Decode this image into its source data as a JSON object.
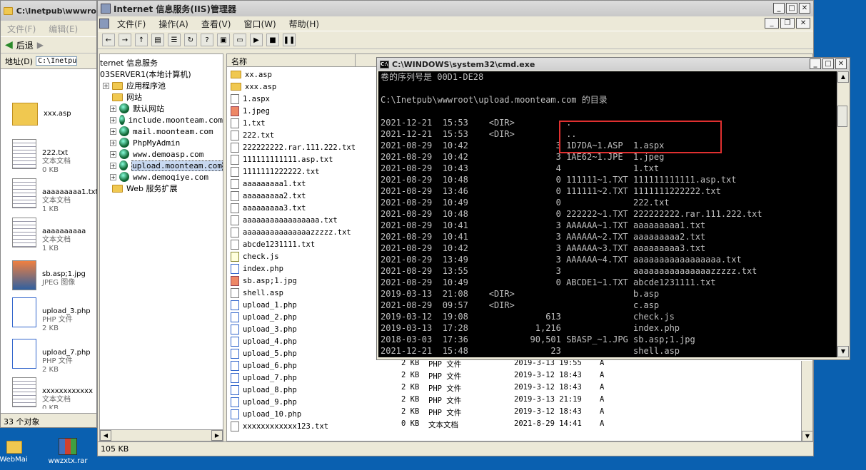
{
  "left_window": {
    "title": "C:\\Inetpub\\wwwro",
    "menu": [
      "文件(F)",
      "编辑(E)"
    ],
    "back_label": "后退",
    "address_label": "地址(D)",
    "address_value": "C:\\Inetpub\\",
    "items": [
      {
        "name": "xxx.asp",
        "type": "",
        "size": "",
        "icon": "folder"
      },
      {
        "name": "222.txt",
        "type": "文本文档",
        "size": "0 KB",
        "icon": "text"
      },
      {
        "name": "aaaaaaaaa1.txt",
        "type": "文本文档",
        "size": "1 KB",
        "icon": "text"
      },
      {
        "name": "aaaaaaaaaa",
        "type": "文本文档",
        "size": "1 KB",
        "icon": "text"
      },
      {
        "name": "sb.asp;1.jpg",
        "type": "JPEG 图像",
        "size": "",
        "icon": "image"
      },
      {
        "name": "upload_3.php",
        "type": "PHP 文件",
        "size": "2 KB",
        "icon": "php"
      },
      {
        "name": "upload_7.php",
        "type": "PHP 文件",
        "size": "2 KB",
        "icon": "php"
      },
      {
        "name": "xxxxxxxxxxxx",
        "type": "文本文档",
        "size": "0 KB",
        "icon": "text"
      }
    ],
    "status": "33 个对象"
  },
  "iis": {
    "title": "Internet 信息服务(IIS)管理器",
    "menu": [
      "文件(F)",
      "操作(A)",
      "查看(V)",
      "窗口(W)",
      "帮助(H)"
    ],
    "tree": [
      {
        "label": "ternet 信息服务",
        "indent": 0,
        "icon": "none",
        "plus": false
      },
      {
        "label": "03SERVER1(本地计算机)",
        "indent": 0,
        "icon": "none",
        "plus": false
      },
      {
        "label": "应用程序池",
        "indent": 1,
        "icon": "folder",
        "plus": true
      },
      {
        "label": "网站",
        "indent": 1,
        "icon": "folder",
        "plus": false
      },
      {
        "label": "默认网站",
        "indent": 2,
        "icon": "globe",
        "plus": true
      },
      {
        "label": "include.moonteam.com",
        "indent": 2,
        "icon": "globe",
        "plus": true
      },
      {
        "label": "mail.moonteam.com",
        "indent": 2,
        "icon": "globe",
        "plus": true
      },
      {
        "label": "PhpMyAdmin",
        "indent": 2,
        "icon": "globe",
        "plus": true
      },
      {
        "label": "www.demoasp.com",
        "indent": 2,
        "icon": "globe",
        "plus": true
      },
      {
        "label": "upload.moonteam.com",
        "indent": 2,
        "icon": "globe",
        "plus": true,
        "selected": true
      },
      {
        "label": "www.demoqiye.com",
        "indent": 2,
        "icon": "globe",
        "plus": true
      },
      {
        "label": "Web 服务扩展",
        "indent": 1,
        "icon": "folder",
        "plus": false
      }
    ],
    "col_name": "名称",
    "files": [
      {
        "name": "xx.asp",
        "icon": "f"
      },
      {
        "name": "xxx.asp",
        "icon": "f"
      },
      {
        "name": "1.aspx",
        "icon": "t"
      },
      {
        "name": "1.jpeg",
        "icon": "j"
      },
      {
        "name": "1.txt",
        "icon": "t"
      },
      {
        "name": "222.txt",
        "icon": "t"
      },
      {
        "name": "222222222.rar.111.222.txt",
        "icon": "t"
      },
      {
        "name": "111111111111.asp.txt",
        "icon": "t"
      },
      {
        "name": "1111111222222.txt",
        "icon": "t"
      },
      {
        "name": "aaaaaaaaa1.txt",
        "icon": "t"
      },
      {
        "name": "aaaaaaaaa2.txt",
        "icon": "t"
      },
      {
        "name": "aaaaaaaaa3.txt",
        "icon": "t"
      },
      {
        "name": "aaaaaaaaaaaaaaaaa.txt",
        "icon": "t"
      },
      {
        "name": "aaaaaaaaaaaaaaazzzzz.txt",
        "icon": "t"
      },
      {
        "name": "abcde1231111.txt",
        "icon": "t"
      },
      {
        "name": "check.js",
        "icon": "s"
      },
      {
        "name": "index.php",
        "icon": "p"
      },
      {
        "name": "sb.asp;1.jpg",
        "icon": "j"
      },
      {
        "name": "shell.asp",
        "icon": "t"
      },
      {
        "name": "upload_1.php",
        "icon": "p"
      },
      {
        "name": "upload_2.php",
        "icon": "p"
      },
      {
        "name": "upload_3.php",
        "icon": "p"
      },
      {
        "name": "upload_4.php",
        "icon": "p"
      },
      {
        "name": "upload_5.php",
        "icon": "p"
      },
      {
        "name": "upload_6.php",
        "icon": "p"
      },
      {
        "name": "upload_7.php",
        "icon": "p"
      },
      {
        "name": "upload_8.php",
        "icon": "p"
      },
      {
        "name": "upload_9.php",
        "icon": "p"
      },
      {
        "name": "upload_10.php",
        "icon": "p"
      },
      {
        "name": "xxxxxxxxxxxx123.txt",
        "icon": "t"
      }
    ],
    "detail_rows": [
      {
        "size": "2 KB",
        "type": "PHP 文件",
        "date": "2019-3-13 19:55",
        "attr": "A"
      },
      {
        "size": "2 KB",
        "type": "PHP 文件",
        "date": "2019-3-12 18:43",
        "attr": "A"
      },
      {
        "size": "2 KB",
        "type": "PHP 文件",
        "date": "2019-3-12 18:43",
        "attr": "A"
      },
      {
        "size": "2 KB",
        "type": "PHP 文件",
        "date": "2019-3-13 21:19",
        "attr": "A"
      },
      {
        "size": "2 KB",
        "type": "PHP 文件",
        "date": "2019-3-12 18:43",
        "attr": "A"
      },
      {
        "size": "0 KB",
        "type": "文本文档",
        "date": "2021-8-29 14:41",
        "attr": "A"
      }
    ],
    "status": "105 KB"
  },
  "cmd": {
    "title": "C:\\WINDOWS\\system32\\cmd.exe",
    "lines": [
      "卷的序列号是 00D1-DE28",
      "",
      "C:\\Inetpub\\wwwroot\\upload.moonteam.com 的目录",
      "",
      "2021-12-21  15:53    <DIR>          .",
      "2021-12-21  15:53    <DIR>          ..",
      "2021-08-29  10:42                 3 1D7DA~1.ASP  1.aspx",
      "2021-08-29  10:42                 3 1AE62~1.JPE  1.jpeg",
      "2021-08-29  10:43                 4              1.txt",
      "2021-08-29  10:48                 0 111111~1.TXT 111111111111.asp.txt",
      "2021-08-29  13:46                 0 111111~2.TXT 1111111222222.txt",
      "2021-08-29  10:49                 0              222.txt",
      "2021-08-29  10:48                 0 222222~1.TXT 222222222.rar.111.222.txt",
      "2021-08-29  10:41                 3 AAAAAA~1.TXT aaaaaaaaa1.txt",
      "2021-08-29  10:41                 3 AAAAAA~2.TXT aaaaaaaaa2.txt",
      "2021-08-29  10:42                 3 AAAAAA~3.TXT aaaaaaaaa3.txt",
      "2021-08-29  13:49                 3 AAAAAA~4.TXT aaaaaaaaaaaaaaaaa.txt",
      "2021-08-29  13:55                 3              aaaaaaaaaaaaaaazzzzz.txt",
      "2021-08-29  10:49                 0 ABCDE1~1.TXT abcde1231111.txt",
      "2019-03-13  21:08    <DIR>                       b.asp",
      "2021-08-29  09:57    <DIR>                       c.asp",
      "2019-03-12  19:08               613              check.js",
      "2019-03-13  17:28             1,216              index.php",
      "2018-03-03  17:36            90,501 SBASP_~1.JPG sb.asp;1.jpg",
      "2021-12-21  15:48                23              shell.asp"
    ]
  },
  "desktop": {
    "icons": [
      "WebMai",
      "wwzxtx.rar"
    ]
  }
}
